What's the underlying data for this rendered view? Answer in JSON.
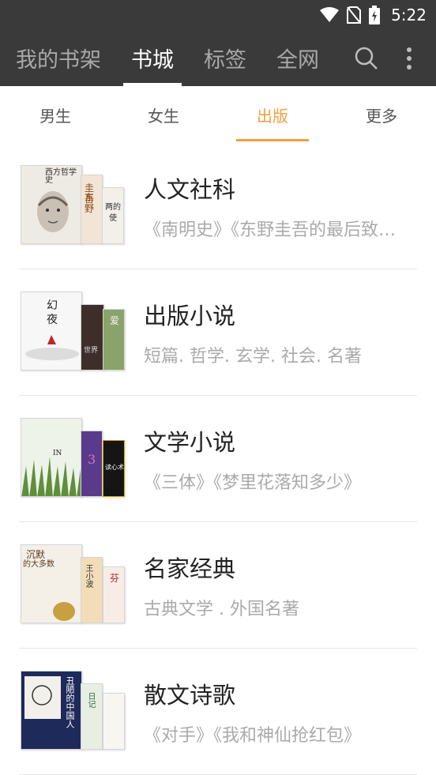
{
  "status_bar": {
    "time": "5:22",
    "icons": [
      "wifi-icon",
      "no-sim-icon",
      "battery-charging-icon"
    ]
  },
  "app_bar": {
    "tabs": [
      {
        "label": "我的书架",
        "active": false
      },
      {
        "label": "书城",
        "active": true
      },
      {
        "label": "标签",
        "active": false
      },
      {
        "label": "全网",
        "active": false
      }
    ],
    "actions": [
      "search-icon",
      "more-vert-icon"
    ]
  },
  "sub_tabs": [
    {
      "label": "男生",
      "active": false
    },
    {
      "label": "女生",
      "active": false
    },
    {
      "label": "出版",
      "active": true
    },
    {
      "label": "更多",
      "active": false
    }
  ],
  "categories": [
    {
      "title": "人文社科",
      "subtitle": "《南明史》《东野圭吾的最后致…",
      "cover_text": [
        "西方哲学史",
        "圭东",
        "吾野",
        "两的",
        "使"
      ]
    },
    {
      "title": "出版小说",
      "subtitle": "短篇. 哲学. 玄学. 社会. 名著",
      "cover_text": [
        "幻",
        "夜",
        "世界",
        "爱"
      ]
    },
    {
      "title": "文学小说",
      "subtitle": "《三体》《梦里花落知多少》",
      "cover_text": [
        "IN",
        "3",
        "读心术"
      ]
    },
    {
      "title": "名家经典",
      "subtitle": "古典文学 . 外国名著",
      "cover_text": [
        "沉默",
        "的大多数",
        "王小波",
        "芬"
      ]
    },
    {
      "title": "散文诗歌",
      "subtitle": "《对手》《我和神仙抢红包》",
      "cover_text": [
        "丑陋的中国人",
        "日记"
      ]
    }
  ],
  "colors": {
    "app_bar_bg": "#3a3a3a",
    "accent": "#f0a040",
    "title_text": "#222222",
    "subtitle_text": "#aaaaaa"
  }
}
